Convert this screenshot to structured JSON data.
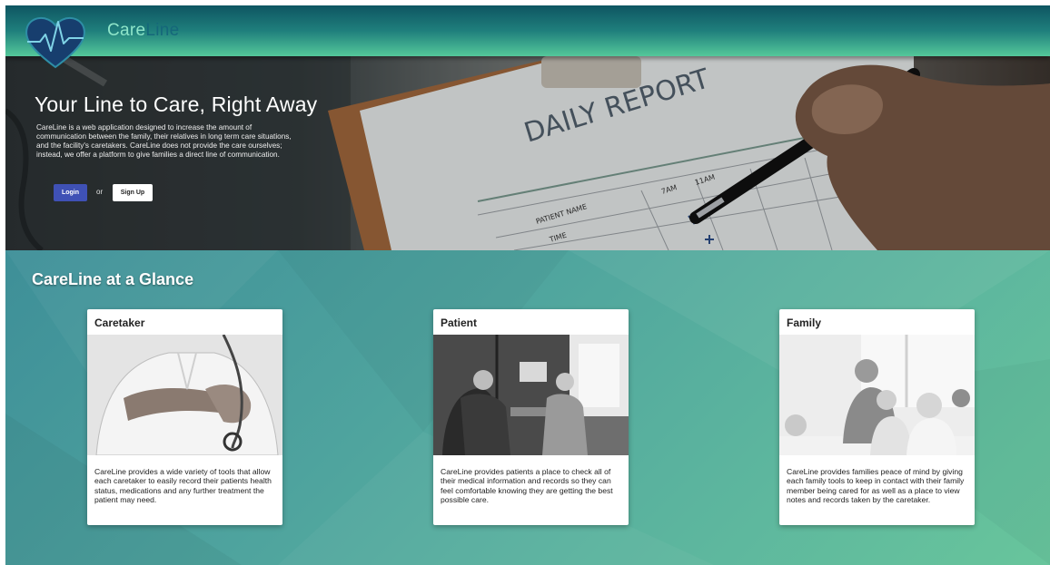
{
  "header": {
    "brand_part1": "Care",
    "brand_part2": "Line",
    "logo_icon": "heart-pulse-icon",
    "colors": {
      "brand_light": "#8fe5c9",
      "brand_dark": "#15677a"
    }
  },
  "hero": {
    "title": "Your Line to Care, Right Away",
    "description": "CareLine is a web application designed to increase the amount of communication between the family, their relatives in long term care situations, and the facility's caretakers. CareLine does not provide the care ourselves; instead, we offer a platform to give families a direct line of communication.",
    "login_label": "Login",
    "or_label": "or",
    "signup_label": "Sign Up",
    "image": {
      "heading": "DAILY REPORT",
      "col_labels": [
        "7AM",
        "11AM"
      ],
      "row_labels": [
        "PATIENT NAME",
        "TIME"
      ]
    },
    "colors": {
      "login_button": "#3f51b5"
    }
  },
  "glance": {
    "title": "CareLine at a Glance",
    "cards": [
      {
        "title": "Caretaker",
        "text": "CareLine provides a wide variety of tools that allow each caretaker to easily record their patients health status, medications and any further treatment the patient may need."
      },
      {
        "title": "Patient",
        "text": "CareLine provides patients a place to check all of their medical information and records so they can feel comfortable knowing they are getting the best possible care."
      },
      {
        "title": "Family",
        "text": "CareLine provides families peace of mind by giving each family tools to keep in contact with their family member being cared for as well as a place to view notes and records taken by the caretaker."
      }
    ]
  }
}
